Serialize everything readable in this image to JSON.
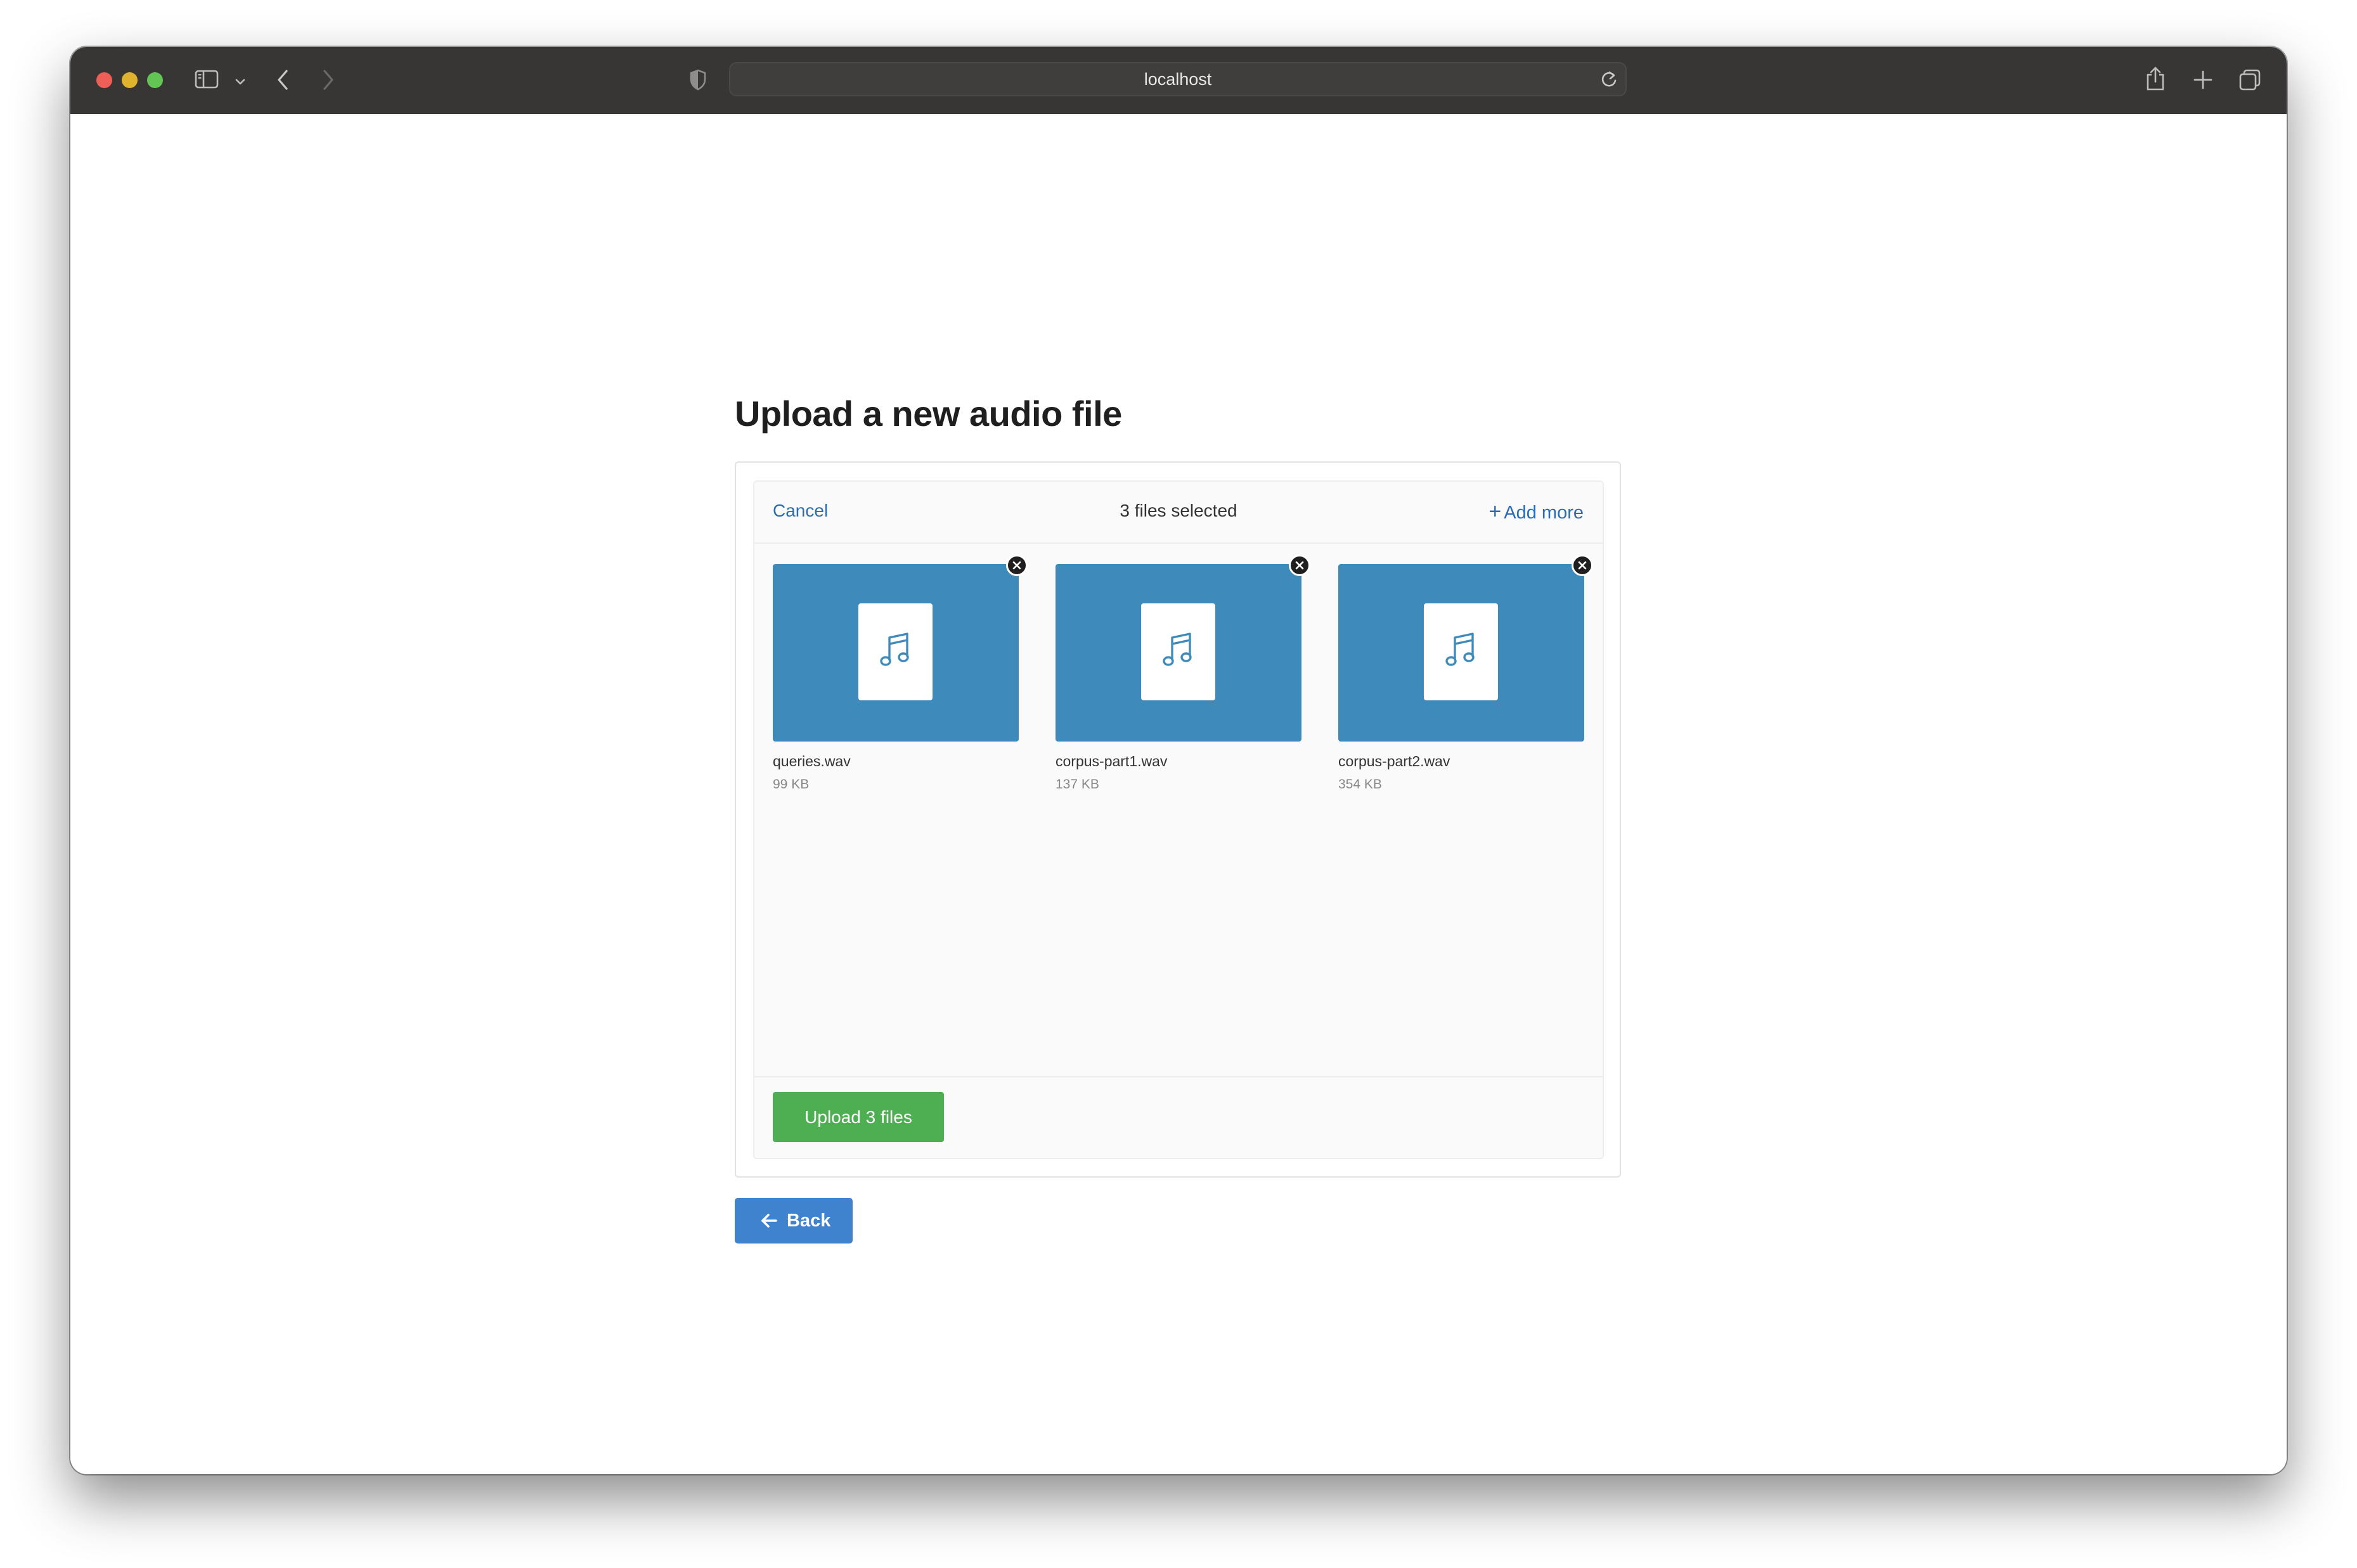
{
  "browser": {
    "address": "localhost"
  },
  "page": {
    "title": "Upload a new audio file"
  },
  "uploader": {
    "cancel_label": "Cancel",
    "selected_text": "3 files selected",
    "add_more_label": "Add more",
    "files": [
      {
        "name": "queries.wav",
        "size": "99 KB"
      },
      {
        "name": "corpus-part1.wav",
        "size": "137 KB"
      },
      {
        "name": "corpus-part2.wav",
        "size": "354 KB"
      }
    ],
    "upload_label": "Upload 3 files"
  },
  "back_label": "Back",
  "colors": {
    "thumbnail": "#3e8bbb",
    "upload_button": "#4eae52",
    "back_button": "#3f82ce",
    "link": "#2b6cb6"
  },
  "icons": {
    "file_type": "music-note-icon",
    "remove": "close-icon",
    "back": "arrow-left-icon"
  }
}
